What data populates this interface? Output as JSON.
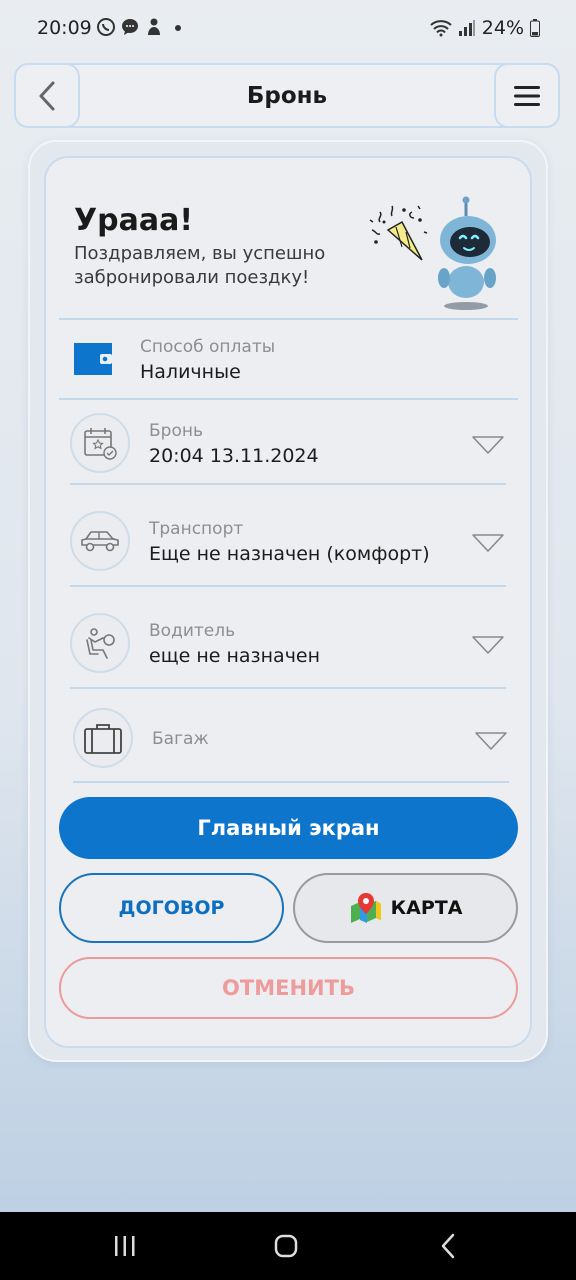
{
  "status_bar": {
    "time": "20:09",
    "battery": "24%",
    "icons": [
      "viber-icon",
      "chat-icon",
      "person-icon",
      "dot-icon",
      "wifi-icon",
      "signal-icon",
      "battery-icon"
    ]
  },
  "header": {
    "title": "Бронь",
    "back_icon": "chevron-left-icon",
    "menu_icon": "hamburger-menu-icon"
  },
  "success": {
    "title": "Урааа!",
    "message": "Поздравляем, вы успешно забронировали поездку!",
    "illustrations": [
      "confetti-icon",
      "robot-mascot-icon"
    ]
  },
  "payment": {
    "label": "Способ оплаты",
    "value": "Наличные",
    "icon": "wallet-icon"
  },
  "rows": [
    {
      "label": "Бронь",
      "value": "20:04 13.11.2024",
      "icon": "calendar-icon"
    },
    {
      "label": "Транспорт",
      "value": "Еще не назначен (комфорт)",
      "icon": "car-icon"
    },
    {
      "label": "Водитель",
      "value": "еще не назначен",
      "icon": "driver-seat-icon"
    },
    {
      "label": "Багаж",
      "value": "",
      "icon": "suitcase-icon"
    }
  ],
  "buttons": {
    "main": "Главный экран",
    "contract": "ДОГОВОР",
    "map": "КАРТА",
    "cancel": "ОТМЕНИТЬ"
  },
  "colors": {
    "accent": "#0d76cc",
    "cancel": "#ee9b9b",
    "border": "#c9dcef"
  }
}
